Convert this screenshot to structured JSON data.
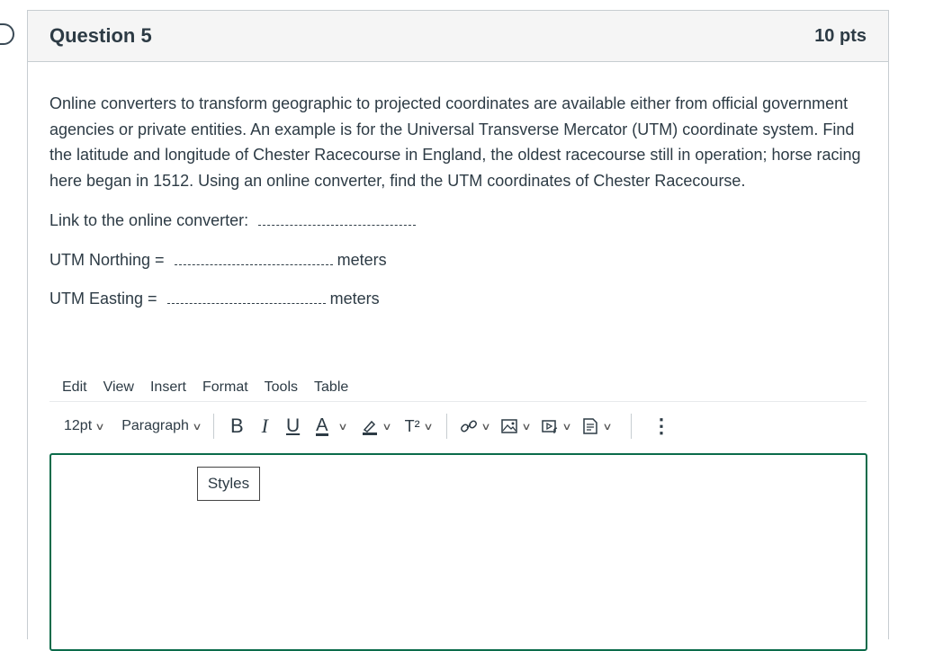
{
  "question": {
    "title": "Question 5",
    "points": "10 pts",
    "text": "Online converters to transform geographic to projected coordinates are available either from official government agencies or private entities. An example is for the Universal Transverse Mercator (UTM) coordinate system. Find the latitude and longitude of Chester Racecourse in England, the oldest racecourse still in operation; horse racing here began in 1512. Using an online converter, find the UTM coordinates of Chester Racecourse.",
    "link_label": "Link to the online converter:",
    "northing_label": "UTM Northing =",
    "northing_unit": "meters",
    "easting_label": "UTM Easting =",
    "easting_unit": "meters"
  },
  "editor": {
    "menu": [
      "Edit",
      "View",
      "Insert",
      "Format",
      "Tools",
      "Table"
    ],
    "font_size": "12pt",
    "block_format": "Paragraph",
    "bold": "B",
    "italic": "I",
    "underline": "U",
    "font_color": "A",
    "superscript": "T²",
    "more": "⋮",
    "styles_popup": "Styles"
  },
  "colors": {
    "editor_border": "#0b6b4a",
    "text": "#2d3b45",
    "header_bg": "#f5f5f5"
  },
  "icons": [
    "flag-icon",
    "chevron-down-icon",
    "highlight-icon",
    "link-icon",
    "image-icon",
    "media-icon",
    "document-icon",
    "more-icon"
  ]
}
